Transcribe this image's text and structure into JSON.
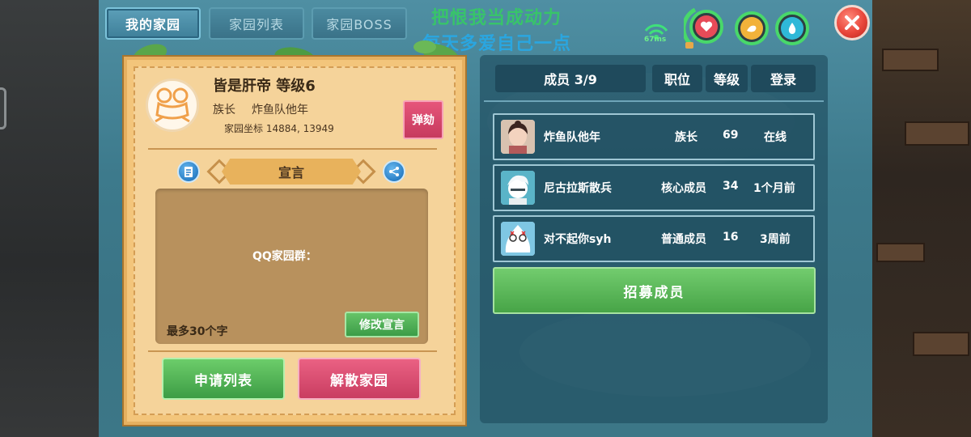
{
  "tabs": [
    {
      "label": "我的家园",
      "active": true
    },
    {
      "label": "家园列表",
      "active": false
    },
    {
      "label": "家园BOSS",
      "active": false
    }
  ],
  "overlay": {
    "line1": "把恨我当成动力",
    "line2": "每天多爱自己一点",
    "line1_color": "#38c46a",
    "line2_color": "#2aa6e0"
  },
  "status": {
    "ping": "67ms"
  },
  "home": {
    "name_level": "皆是肝帝 等级6",
    "leader_label": "族长",
    "leader_name": "炸鱼队他年",
    "coord": "家园坐标 14884, 13949",
    "impeach_label": "弹劾",
    "declaration_title": "宣言",
    "declaration_text": "QQ家园群：",
    "max_hint": "最多30个字",
    "edit_label": "修改宣言",
    "apply_list_label": "申请列表",
    "dissolve_label": "解散家园"
  },
  "members": {
    "header_count": "成员 3/9",
    "header_position": "职位",
    "header_level": "等级",
    "header_login": "登录",
    "rows": [
      {
        "name": "炸鱼队他年",
        "position": "族长",
        "level": "69",
        "login": "在线"
      },
      {
        "name": "尼古拉斯散兵",
        "position": "核心成员",
        "level": "34",
        "login": "1个月前"
      },
      {
        "name": "对不起你syh",
        "position": "普通成员",
        "level": "16",
        "login": "3周前"
      }
    ],
    "recruit_label": "招募成员"
  },
  "colors": {
    "accent_green": "#47a447",
    "accent_red": "#c93d61",
    "parchment": "#f5d39a",
    "panel_teal": "#3d7a8c"
  }
}
